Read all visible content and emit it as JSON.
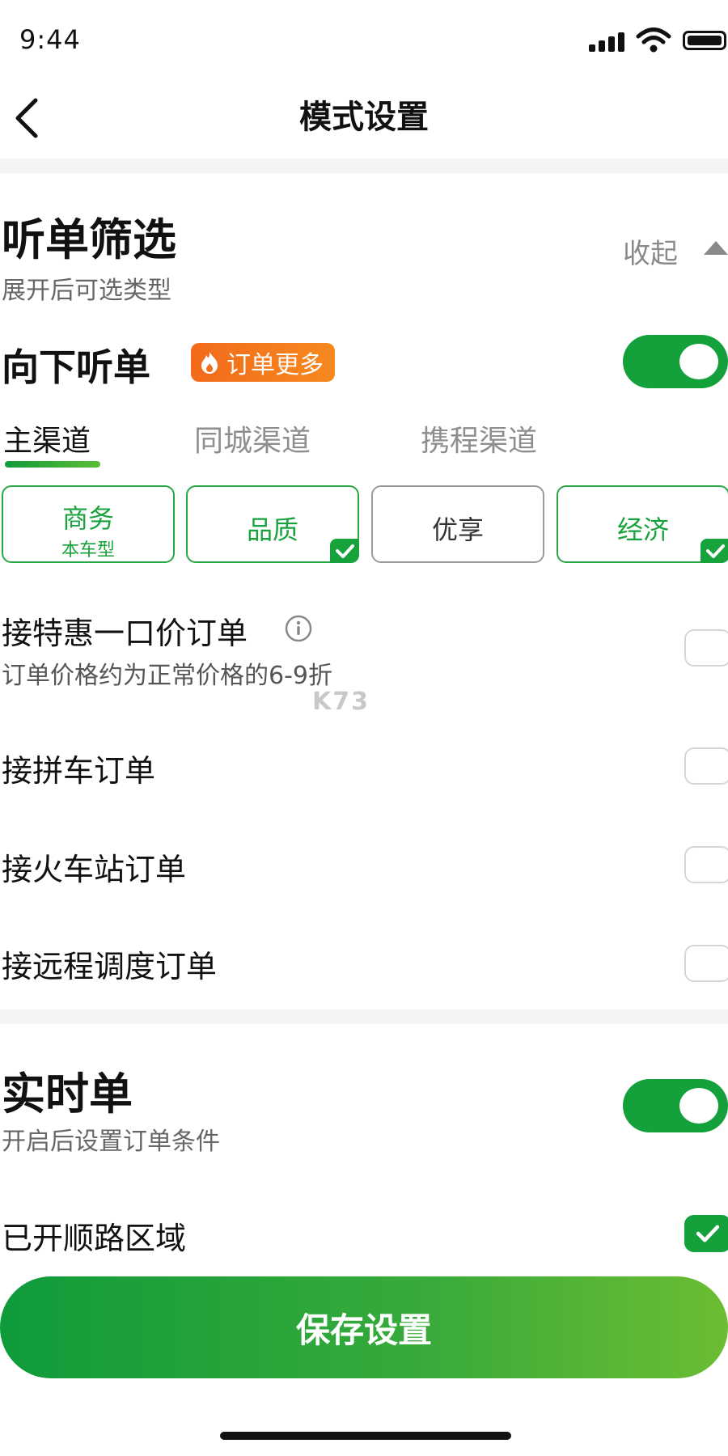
{
  "status_bar": {
    "time": "9:44"
  },
  "nav": {
    "title": "模式设置"
  },
  "section_filter": {
    "title": "听单筛选",
    "subtitle": "展开后可选类型",
    "collapse_label": "收起",
    "down_listen": {
      "label": "向下听单",
      "badge": "订单更多",
      "enabled": true
    },
    "tabs": [
      {
        "label": "主渠道",
        "active": true
      },
      {
        "label": "同城渠道",
        "active": false
      },
      {
        "label": "携程渠道",
        "active": false
      }
    ],
    "car_types": [
      {
        "label": "商务",
        "sub": "本车型",
        "selected": true,
        "checked": false
      },
      {
        "label": "品质",
        "sub": "",
        "selected": true,
        "checked": true
      },
      {
        "label": "优享",
        "sub": "",
        "selected": false,
        "checked": false
      },
      {
        "label": "经济",
        "sub": "",
        "selected": true,
        "checked": true
      }
    ],
    "options": [
      {
        "label": "接特惠一口价订单",
        "desc": "订单价格约为正常价格的6-9折",
        "checked": false
      },
      {
        "label": "接拼车订单",
        "checked": false
      },
      {
        "label": "接火车站订单",
        "checked": false
      },
      {
        "label": "接远程调度订单",
        "checked": false
      }
    ]
  },
  "section_realtime": {
    "title": "实时单",
    "subtitle": "开启后设置订单条件",
    "enabled": true,
    "route_area": {
      "label": "已开顺路区域",
      "checked": true
    }
  },
  "watermark": "K73",
  "save_button": {
    "label": "保存设置"
  },
  "colors": {
    "accent": "#14a03a",
    "badge": "#f26a1b",
    "muted": "#8a8a8a"
  }
}
